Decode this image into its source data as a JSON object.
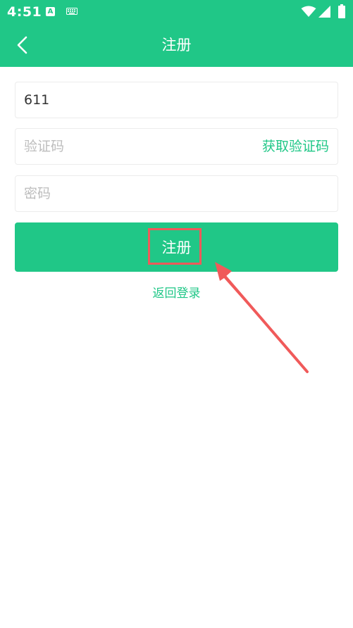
{
  "status_bar": {
    "time": "4:51",
    "icons": [
      "text-input-icon",
      "keyboard-icon",
      "wifi-icon",
      "signal-icon",
      "battery-icon"
    ]
  },
  "header": {
    "title": "注册",
    "back_icon": "chevron-left-icon"
  },
  "form": {
    "phone_value": "611",
    "code_placeholder": "验证码",
    "get_code_label": "获取验证码",
    "password_placeholder": "密码",
    "submit_label": "注册",
    "back_to_login_label": "返回登录"
  },
  "colors": {
    "brand": "#20c787",
    "annotation": "#f05a5a",
    "placeholder": "#bdbdbd"
  }
}
